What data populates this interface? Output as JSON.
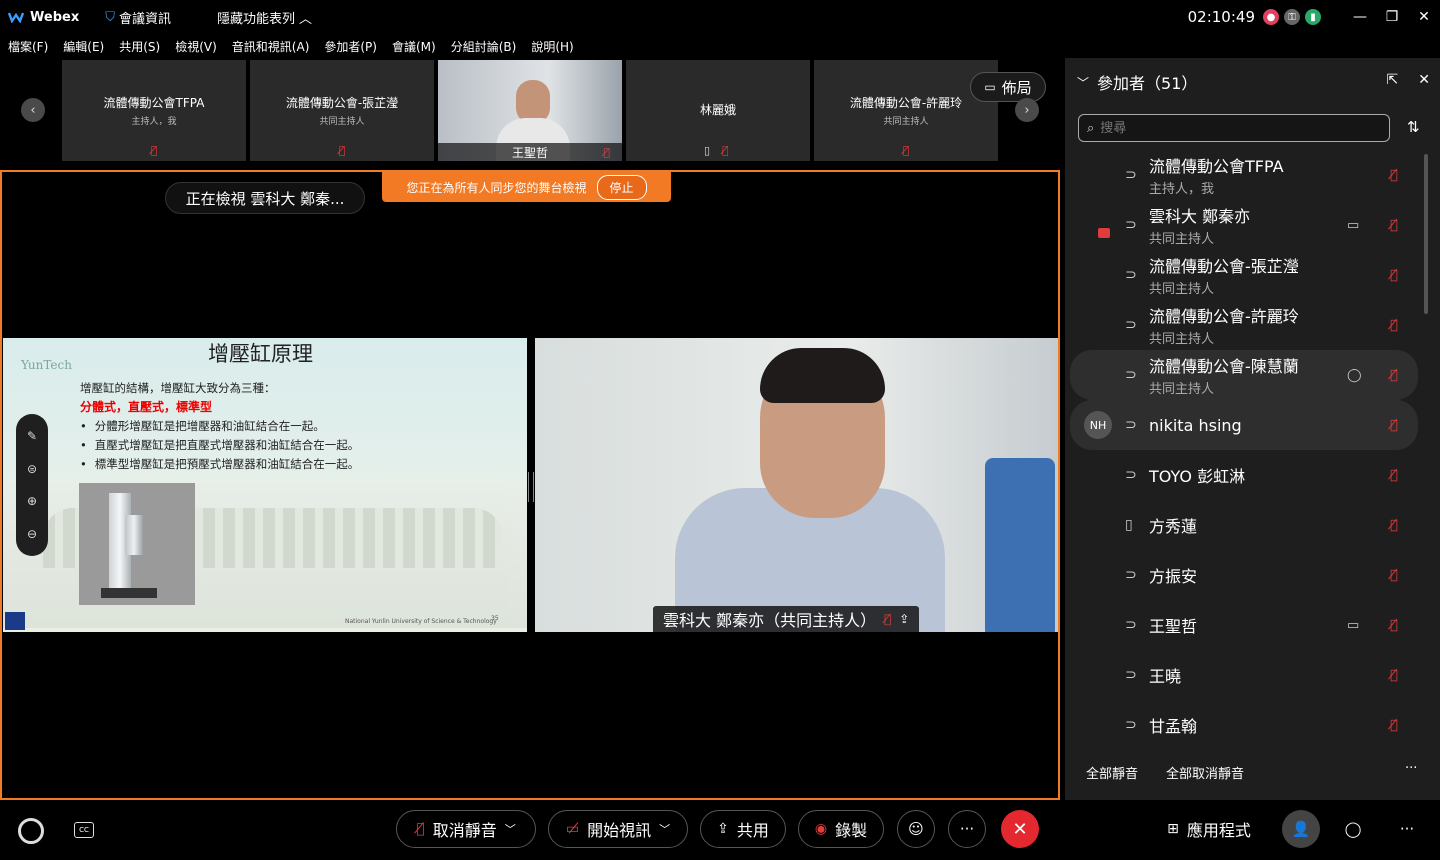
{
  "titlebar": {
    "app_name": "Webex",
    "meeting_info": "會議資訊",
    "hide_menu": "隱藏功能表列",
    "clock": "02:10:49",
    "minimize": "—",
    "restore": "❐",
    "close": "✕"
  },
  "menu": [
    "檔案(F)",
    "編輯(E)",
    "共用(S)",
    "檢視(V)",
    "音訊和視訊(A)",
    "參加者(P)",
    "會議(M)",
    "分組討論(B)",
    "說明(H)"
  ],
  "filmstrip": {
    "tiles": [
      {
        "name": "流體傳動公會TFPA",
        "role": "主持人，我"
      },
      {
        "name": "流體傳動公會-張芷瀅",
        "role": "共同主持人"
      },
      {
        "name": "王聖哲",
        "role": ""
      },
      {
        "name": "林麗娥",
        "role": ""
      },
      {
        "name": "流體傳動公會-許麗玲",
        "role": "共同主持人"
      }
    ],
    "layout_label": "佈局"
  },
  "stage": {
    "viewing": "正在檢視 雲科大 鄭秦...",
    "sync_text": "您正在為所有人同步您的舞台檢視",
    "sync_stop": "停止",
    "slide": {
      "logo": "YunTech",
      "title": "增壓缸原理",
      "intro": "增壓缸的結構，增壓缸大致分為三種：",
      "types": "分體式，直壓式，標準型",
      "bullets": [
        "分體形增壓缸是把增壓器和油缸結合在一起。",
        "直壓式增壓缸是把直壓式增壓器和油缸結合在一起。",
        "標準型增壓缸是把預壓式增壓器和油缸結合在一起。"
      ],
      "footer": "National Yunlin University of Science & Technology",
      "page_number": "35"
    },
    "video_label": "雲科大 鄭秦亦（共同主持人）"
  },
  "panel": {
    "title": "參加者（51）",
    "search_placeholder": "搜尋",
    "participants": [
      {
        "name": "流體傳動公會TFPA",
        "role": "主持人，我",
        "initials": "",
        "camera": false
      },
      {
        "name": "雲科大 鄭秦亦",
        "role": "共同主持人",
        "initials": "",
        "camera": true
      },
      {
        "name": "流體傳動公會-張芷瀅",
        "role": "共同主持人",
        "initials": "",
        "camera": false
      },
      {
        "name": "流體傳動公會-許麗玲",
        "role": "共同主持人",
        "initials": "",
        "camera": false
      },
      {
        "name": "流體傳動公會-陳慧蘭",
        "role": "共同主持人",
        "initials": "",
        "camera": false
      },
      {
        "name": "nikita hsing",
        "role": "",
        "initials": "NH",
        "camera": false
      },
      {
        "name": "TOYO 彭虹淋",
        "role": "",
        "initials": "",
        "camera": false
      },
      {
        "name": "方秀蓮",
        "role": "",
        "initials": "",
        "camera": false
      },
      {
        "name": "方振安",
        "role": "",
        "initials": "",
        "camera": false
      },
      {
        "name": "王聖哲",
        "role": "",
        "initials": "",
        "camera": true
      },
      {
        "name": "王曉",
        "role": "",
        "initials": "",
        "camera": false
      },
      {
        "name": "甘孟翰",
        "role": "",
        "initials": "",
        "camera": false
      }
    ],
    "mute_all": "全部靜音",
    "unmute_all": "全部取消靜音",
    "more": "···"
  },
  "controls": {
    "unmute": "取消靜音",
    "start_video": "開始視訊",
    "share": "共用",
    "record": "錄製",
    "more": "···",
    "apps": "應用程式",
    "more_right": "···"
  },
  "colors": {
    "accent_orange": "#f27a24",
    "mute_red": "#e03c3c",
    "end_call_red": "#e3282f"
  }
}
